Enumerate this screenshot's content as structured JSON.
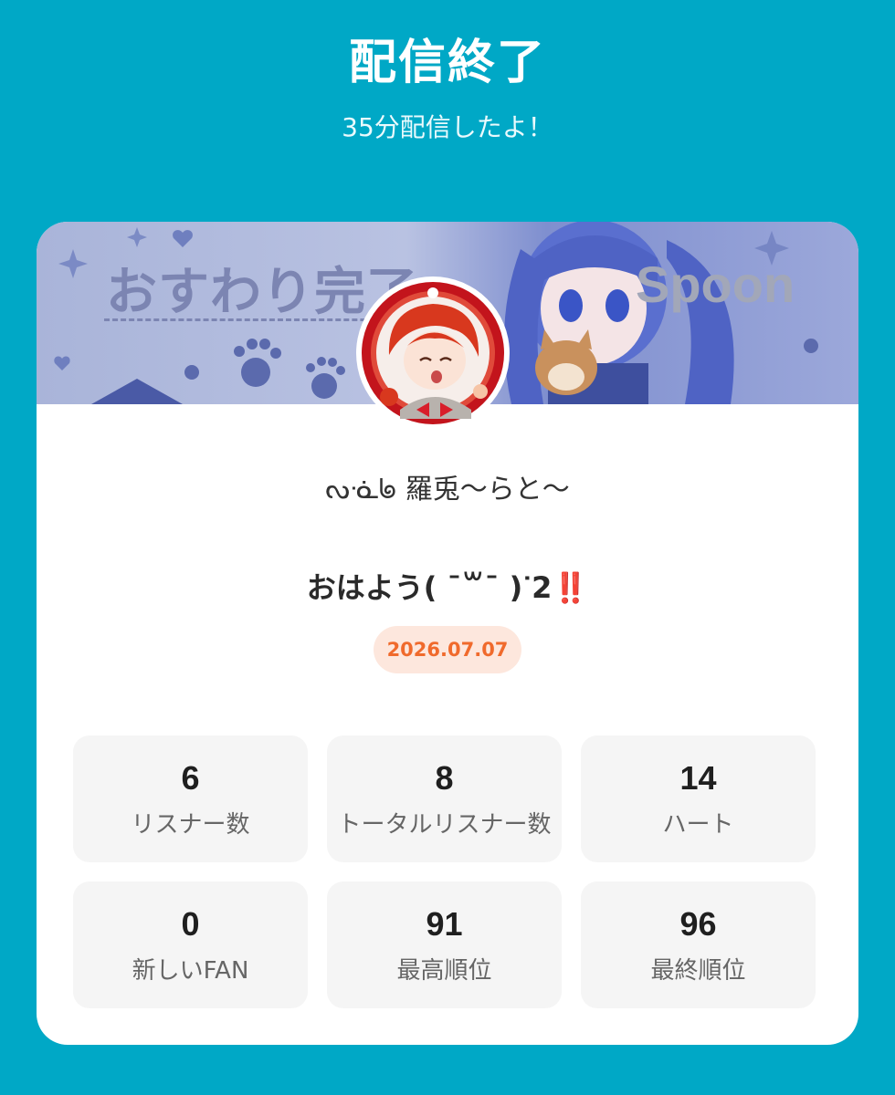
{
  "header": {
    "title": "配信終了",
    "subtitle": "35分配信したよ！"
  },
  "banner": {
    "text": "おすわり完了",
    "logo": "Spoon"
  },
  "profile": {
    "username": "ᔓᓍᖚ 羅兎〜らと〜"
  },
  "live": {
    "title": "おはよう( ˉ꒳ˉ )ᐝ2",
    "title_emoji": "‼️",
    "date": "2026.07.07"
  },
  "stats": [
    {
      "value": "6",
      "label": "リスナー数"
    },
    {
      "value": "8",
      "label": "トータルリスナー数"
    },
    {
      "value": "14",
      "label": "ハート"
    },
    {
      "value": "0",
      "label": "新しいFAN"
    },
    {
      "value": "91",
      "label": "最高順位"
    },
    {
      "value": "96",
      "label": "最終順位"
    }
  ],
  "colors": {
    "background": "#00a8c6",
    "date_pill_bg": "#fde7dd",
    "date_pill_text": "#f06a2c",
    "stat_bg": "#f5f5f5"
  }
}
